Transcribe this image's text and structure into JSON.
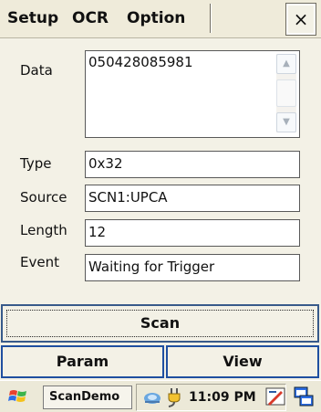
{
  "menubar": {
    "items": [
      "Setup",
      "OCR",
      "Option"
    ],
    "close_label": "×"
  },
  "form": {
    "data_label": "Data",
    "data_value": "050428085981",
    "type_label": "Type",
    "type_value": "0x32",
    "source_label": "Source",
    "source_value": "SCN1:UPCA",
    "length_label": "Length",
    "length_value": "12",
    "event_label": "Event",
    "event_value": "Waiting for Trigger"
  },
  "buttons": {
    "scan": "Scan",
    "param": "Param",
    "view": "View"
  },
  "taskbar": {
    "app_label": "ScanDemo",
    "clock": "11:09 PM",
    "icons": [
      "start-flag-icon",
      "network-icon",
      "power-plug-icon",
      "edit-icon",
      "windows-switch-icon"
    ]
  },
  "colors": {
    "accent": "#1f4fa0",
    "focus": "#385a8a",
    "background": "#f3f1e6"
  }
}
